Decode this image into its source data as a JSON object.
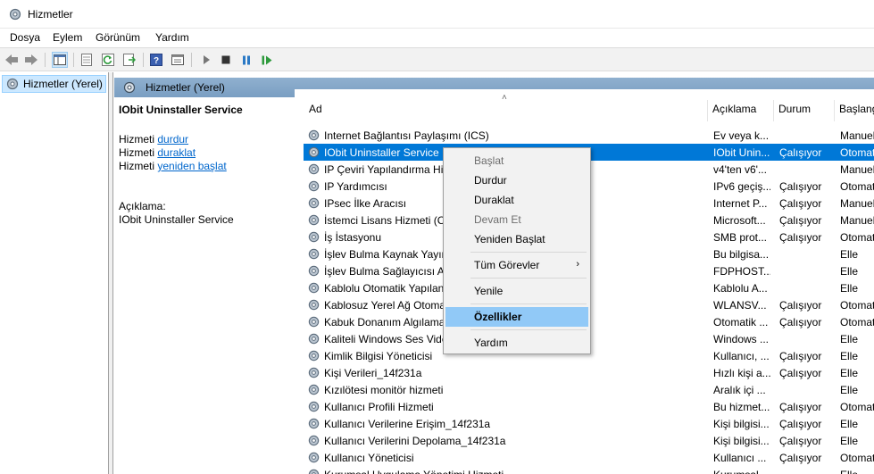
{
  "window": {
    "title": "Hizmetler"
  },
  "menu": [
    "Dosya",
    "Eylem",
    "Görünüm",
    "Yardım"
  ],
  "tree": {
    "item": "Hizmetler (Yerel)"
  },
  "pane": {
    "header": "Hizmetler (Yerel)",
    "service_name": "IObit Uninstaller Service",
    "actions": [
      {
        "prefix": "Hizmeti ",
        "link": "durdur"
      },
      {
        "prefix": "Hizmeti ",
        "link": "duraklat"
      },
      {
        "prefix": "Hizmeti ",
        "link": "yeniden başlat"
      }
    ],
    "desc_label": "Açıklama:",
    "desc_value": "IObit Uninstaller Service"
  },
  "columns": {
    "name": "Ad",
    "desc": "Açıklama",
    "status": "Durum",
    "start": "Başlangıç"
  },
  "rows": [
    {
      "name": "Internet Bağlantısı Paylaşımı (ICS)",
      "desc": "Ev veya k...",
      "status": "",
      "start": "Manuel"
    },
    {
      "name": "IObit Uninstaller Service",
      "desc": "IObit Unin...",
      "status": "Çalışıyor",
      "start": "Otomatik",
      "selected": true
    },
    {
      "name": "IP Çeviri Yapılandırma Hizmeti",
      "desc": "v4'ten v6'...",
      "status": "",
      "start": "Manuel"
    },
    {
      "name": "IP Yardımcısı",
      "desc": "IPv6 geçiş...",
      "status": "Çalışıyor",
      "start": "Otomatik"
    },
    {
      "name": "IPsec İlke Aracısı",
      "desc": "Internet P...",
      "status": "Çalışıyor",
      "start": "Manuel"
    },
    {
      "name": "İstemci Lisans Hizmeti (ClipSVC)",
      "desc": "Microsoft...",
      "status": "Çalışıyor",
      "start": "Manuel"
    },
    {
      "name": "İş İstasyonu",
      "desc": "SMB prot...",
      "status": "Çalışıyor",
      "start": "Otomatik"
    },
    {
      "name": "İşlev Bulma Kaynak Yayımı",
      "desc": "Bu bilgisa...",
      "status": "",
      "start": "Elle"
    },
    {
      "name": "İşlev Bulma Sağlayıcısı Ana Bilgisayarı",
      "desc": "FDPHOST...",
      "status": "",
      "start": "Elle"
    },
    {
      "name": "Kablolu Otomatik Yapılandırma",
      "desc": "Kablolu A...",
      "status": "",
      "start": "Elle"
    },
    {
      "name": "Kablosuz Yerel Ağ Otomatik Yapılandırma",
      "desc": "WLANSV...",
      "status": "Çalışıyor",
      "start": "Otomatik"
    },
    {
      "name": "Kabuk Donanım Algılama",
      "desc": "Otomatik ...",
      "status": "Çalışıyor",
      "start": "Otomatik"
    },
    {
      "name": "Kaliteli Windows Ses Video Deneyimi",
      "desc": "Windows ...",
      "status": "",
      "start": "Elle"
    },
    {
      "name": "Kimlik Bilgisi Yöneticisi",
      "desc": "Kullanıcı, ...",
      "status": "Çalışıyor",
      "start": "Elle"
    },
    {
      "name": "Kişi Verileri_14f231a",
      "desc": "Hızlı kişi a...",
      "status": "Çalışıyor",
      "start": "Elle"
    },
    {
      "name": "Kızılötesi monitör hizmeti",
      "desc": "Aralık içi ...",
      "status": "",
      "start": "Elle"
    },
    {
      "name": "Kullanıcı Profili Hizmeti",
      "desc": "Bu hizmet...",
      "status": "Çalışıyor",
      "start": "Otomatik"
    },
    {
      "name": "Kullanıcı Verilerine Erişim_14f231a",
      "desc": "Kişi bilgisi...",
      "status": "Çalışıyor",
      "start": "Elle"
    },
    {
      "name": "Kullanıcı Verilerini Depolama_14f231a",
      "desc": "Kişi bilgisi...",
      "status": "Çalışıyor",
      "start": "Elle"
    },
    {
      "name": "Kullanıcı Yöneticisi",
      "desc": "Kullanıcı ...",
      "status": "Çalışıyor",
      "start": "Otomatik"
    },
    {
      "name": "Kurumsal Uygulama Yönetimi Hizmeti",
      "desc": "Kurumsal ...",
      "status": "",
      "start": "Elle"
    }
  ],
  "context_menu": {
    "start": "Başlat",
    "stop": "Durdur",
    "pause": "Duraklat",
    "resume": "Devam Et",
    "restart": "Yeniden Başlat",
    "all_tasks": "Tüm Görevler",
    "refresh": "Yenile",
    "properties": "Özellikler",
    "help": "Yardım"
  },
  "colors": {
    "selection": "#0078d7",
    "menu_hover": "#91c9f7",
    "pane_header": "#86a9cc",
    "link": "#0066cc"
  }
}
